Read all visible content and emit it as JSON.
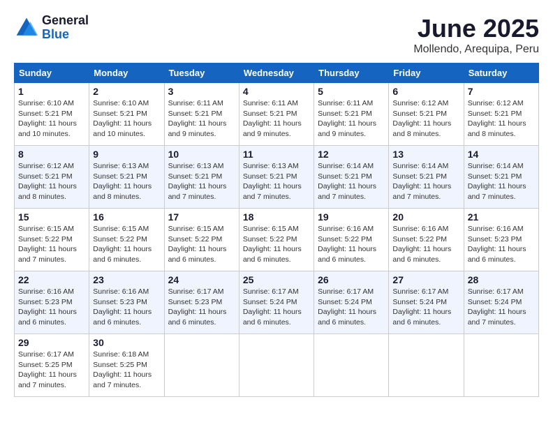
{
  "header": {
    "logo": {
      "general": "General",
      "blue": "Blue"
    },
    "title": "June 2025",
    "location": "Mollendo, Arequipa, Peru"
  },
  "calendar": {
    "weekdays": [
      "Sunday",
      "Monday",
      "Tuesday",
      "Wednesday",
      "Thursday",
      "Friday",
      "Saturday"
    ],
    "weeks": [
      [
        null,
        {
          "day": "2",
          "sunrise": "Sunrise: 6:10 AM",
          "sunset": "Sunset: 5:21 PM",
          "daylight": "Daylight: 11 hours and 10 minutes."
        },
        {
          "day": "3",
          "sunrise": "Sunrise: 6:11 AM",
          "sunset": "Sunset: 5:21 PM",
          "daylight": "Daylight: 11 hours and 9 minutes."
        },
        {
          "day": "4",
          "sunrise": "Sunrise: 6:11 AM",
          "sunset": "Sunset: 5:21 PM",
          "daylight": "Daylight: 11 hours and 9 minutes."
        },
        {
          "day": "5",
          "sunrise": "Sunrise: 6:11 AM",
          "sunset": "Sunset: 5:21 PM",
          "daylight": "Daylight: 11 hours and 9 minutes."
        },
        {
          "day": "6",
          "sunrise": "Sunrise: 6:12 AM",
          "sunset": "Sunset: 5:21 PM",
          "daylight": "Daylight: 11 hours and 8 minutes."
        },
        {
          "day": "7",
          "sunrise": "Sunrise: 6:12 AM",
          "sunset": "Sunset: 5:21 PM",
          "daylight": "Daylight: 11 hours and 8 minutes."
        }
      ],
      [
        {
          "day": "1",
          "sunrise": "Sunrise: 6:10 AM",
          "sunset": "Sunset: 5:21 PM",
          "daylight": "Daylight: 11 hours and 10 minutes."
        },
        null,
        null,
        null,
        null,
        null,
        null
      ],
      [
        {
          "day": "8",
          "sunrise": "Sunrise: 6:12 AM",
          "sunset": "Sunset: 5:21 PM",
          "daylight": "Daylight: 11 hours and 8 minutes."
        },
        {
          "day": "9",
          "sunrise": "Sunrise: 6:13 AM",
          "sunset": "Sunset: 5:21 PM",
          "daylight": "Daylight: 11 hours and 8 minutes."
        },
        {
          "day": "10",
          "sunrise": "Sunrise: 6:13 AM",
          "sunset": "Sunset: 5:21 PM",
          "daylight": "Daylight: 11 hours and 7 minutes."
        },
        {
          "day": "11",
          "sunrise": "Sunrise: 6:13 AM",
          "sunset": "Sunset: 5:21 PM",
          "daylight": "Daylight: 11 hours and 7 minutes."
        },
        {
          "day": "12",
          "sunrise": "Sunrise: 6:14 AM",
          "sunset": "Sunset: 5:21 PM",
          "daylight": "Daylight: 11 hours and 7 minutes."
        },
        {
          "day": "13",
          "sunrise": "Sunrise: 6:14 AM",
          "sunset": "Sunset: 5:21 PM",
          "daylight": "Daylight: 11 hours and 7 minutes."
        },
        {
          "day": "14",
          "sunrise": "Sunrise: 6:14 AM",
          "sunset": "Sunset: 5:21 PM",
          "daylight": "Daylight: 11 hours and 7 minutes."
        }
      ],
      [
        {
          "day": "15",
          "sunrise": "Sunrise: 6:15 AM",
          "sunset": "Sunset: 5:22 PM",
          "daylight": "Daylight: 11 hours and 7 minutes."
        },
        {
          "day": "16",
          "sunrise": "Sunrise: 6:15 AM",
          "sunset": "Sunset: 5:22 PM",
          "daylight": "Daylight: 11 hours and 6 minutes."
        },
        {
          "day": "17",
          "sunrise": "Sunrise: 6:15 AM",
          "sunset": "Sunset: 5:22 PM",
          "daylight": "Daylight: 11 hours and 6 minutes."
        },
        {
          "day": "18",
          "sunrise": "Sunrise: 6:15 AM",
          "sunset": "Sunset: 5:22 PM",
          "daylight": "Daylight: 11 hours and 6 minutes."
        },
        {
          "day": "19",
          "sunrise": "Sunrise: 6:16 AM",
          "sunset": "Sunset: 5:22 PM",
          "daylight": "Daylight: 11 hours and 6 minutes."
        },
        {
          "day": "20",
          "sunrise": "Sunrise: 6:16 AM",
          "sunset": "Sunset: 5:22 PM",
          "daylight": "Daylight: 11 hours and 6 minutes."
        },
        {
          "day": "21",
          "sunrise": "Sunrise: 6:16 AM",
          "sunset": "Sunset: 5:23 PM",
          "daylight": "Daylight: 11 hours and 6 minutes."
        }
      ],
      [
        {
          "day": "22",
          "sunrise": "Sunrise: 6:16 AM",
          "sunset": "Sunset: 5:23 PM",
          "daylight": "Daylight: 11 hours and 6 minutes."
        },
        {
          "day": "23",
          "sunrise": "Sunrise: 6:16 AM",
          "sunset": "Sunset: 5:23 PM",
          "daylight": "Daylight: 11 hours and 6 minutes."
        },
        {
          "day": "24",
          "sunrise": "Sunrise: 6:17 AM",
          "sunset": "Sunset: 5:23 PM",
          "daylight": "Daylight: 11 hours and 6 minutes."
        },
        {
          "day": "25",
          "sunrise": "Sunrise: 6:17 AM",
          "sunset": "Sunset: 5:24 PM",
          "daylight": "Daylight: 11 hours and 6 minutes."
        },
        {
          "day": "26",
          "sunrise": "Sunrise: 6:17 AM",
          "sunset": "Sunset: 5:24 PM",
          "daylight": "Daylight: 11 hours and 6 minutes."
        },
        {
          "day": "27",
          "sunrise": "Sunrise: 6:17 AM",
          "sunset": "Sunset: 5:24 PM",
          "daylight": "Daylight: 11 hours and 6 minutes."
        },
        {
          "day": "28",
          "sunrise": "Sunrise: 6:17 AM",
          "sunset": "Sunset: 5:24 PM",
          "daylight": "Daylight: 11 hours and 7 minutes."
        }
      ],
      [
        {
          "day": "29",
          "sunrise": "Sunrise: 6:17 AM",
          "sunset": "Sunset: 5:25 PM",
          "daylight": "Daylight: 11 hours and 7 minutes."
        },
        {
          "day": "30",
          "sunrise": "Sunrise: 6:18 AM",
          "sunset": "Sunset: 5:25 PM",
          "daylight": "Daylight: 11 hours and 7 minutes."
        },
        null,
        null,
        null,
        null,
        null
      ]
    ]
  }
}
